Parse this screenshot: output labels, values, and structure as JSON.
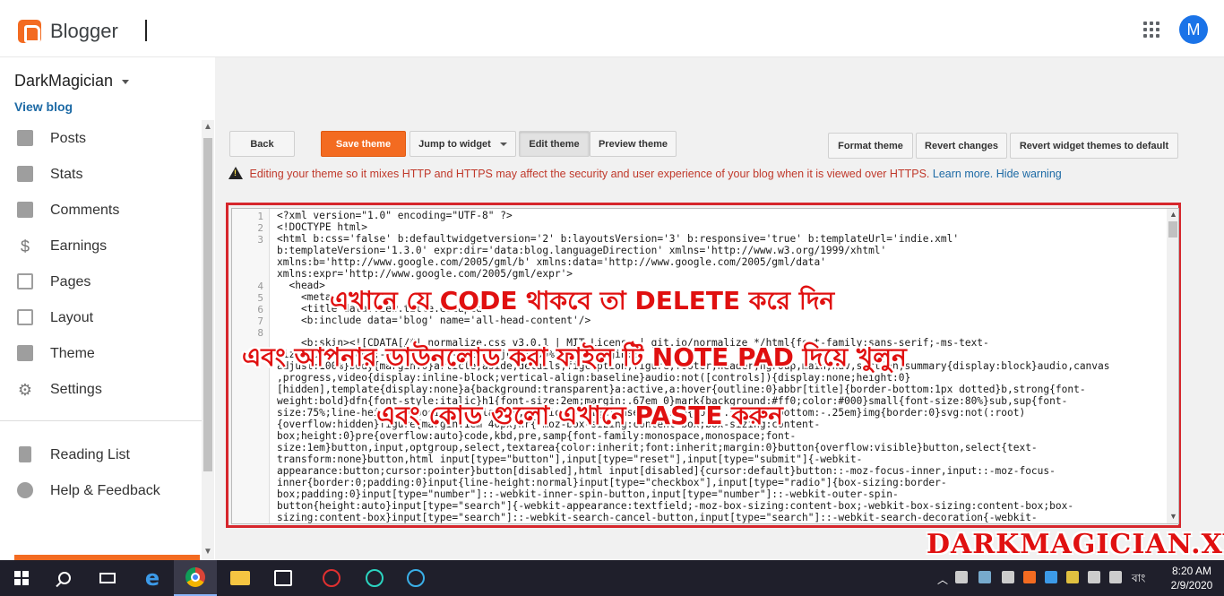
{
  "topbar": {
    "brand": "Blogger",
    "avatar_letter": "M"
  },
  "sidebar": {
    "blog_name": "DarkMagician",
    "view_blog": "View blog",
    "items": [
      {
        "label": "Posts",
        "icon": "posts-icon"
      },
      {
        "label": "Stats",
        "icon": "stats-icon"
      },
      {
        "label": "Comments",
        "icon": "comments-icon"
      },
      {
        "label": "Earnings",
        "icon": "dollar-icon"
      },
      {
        "label": "Pages",
        "icon": "pages-icon"
      },
      {
        "label": "Layout",
        "icon": "layout-icon"
      },
      {
        "label": "Theme",
        "icon": "theme-icon"
      },
      {
        "label": "Settings",
        "icon": "gear-icon"
      }
    ],
    "secondary": [
      {
        "label": "Reading List",
        "icon": "bookmark-icon"
      },
      {
        "label": "Help & Feedback",
        "icon": "help-icon"
      }
    ]
  },
  "toolbar": {
    "back": "Back",
    "save_theme": "Save theme",
    "jump_to_widget": "Jump to widget",
    "edit_theme": "Edit theme",
    "preview_theme": "Preview theme",
    "format_theme": "Format theme",
    "revert_changes": "Revert changes",
    "revert_widget": "Revert widget themes to default"
  },
  "warning": {
    "text": "Editing your theme so it mixes HTTP and HTTPS may affect the security and user experience of your blog when it is viewed over HTTPS.",
    "learn_more": "Learn more.",
    "hide": "Hide warning"
  },
  "editor": {
    "line_numbers": [
      "1",
      "2",
      "3",
      "",
      "",
      "",
      "4",
      "5",
      "6",
      "7",
      "8"
    ],
    "lines": [
      "<?xml version=\"1.0\" encoding=\"UTF-8\" ?>",
      "<!DOCTYPE html>",
      "<html b:css='false' b:defaultwidgetversion='2' b:layoutsVersion='3' b:responsive='true' b:templateUrl='indie.xml'",
      "b:templateVersion='1.3.0' expr:dir='data:blog.languageDirection' xmlns='http://www.w3.org/1999/xhtml'",
      "xmlns:b='http://www.google.com/2005/gml/b' xmlns:data='http://www.google.com/2005/gml/data'",
      "xmlns:expr='http://www.google.com/2005/gml/expr'>",
      "  <head>",
      "    <meta",
      "    <title data:view.title.escaped",
      "    <b:include data='blog' name='all-head-content'/>",
      "",
      "    <b:skin><![CDATA[/*! normalize.css v3.0.1 | MIT License | git.io/normalize */html{font-family:sans-serif;-ms-text-",
      "size-adjust:100%;-webkit-text-size-adjust:100%}body{margin:0}",
      "adjust:100%}body{margin:0}article,aside,details,figcaption,figure,footer,header,hgroup,main,nav,section,summary{display:block}audio,canvas",
      ",progress,video{display:inline-block;vertical-align:baseline}audio:not([controls]){display:none;height:0}",
      "[hidden],template{display:none}a{background:transparent}a:active,a:hover{outline:0}abbr[title]{border-bottom:1px dotted}b,strong{font-",
      "weight:bold}dfn{font-style:italic}h1{font-size:2em;margin:.67em 0}mark{background:#ff0;color:#000}small{font-size:80%}sub,sup{font-",
      "size:75%;line-height:0;position:relative;vertical-align:baseline}sup{top:-.5em}sub{bottom:-.25em}img{border:0}svg:not(:root)",
      "{overflow:hidden}figure{margin:1em 40px}hr{-moz-box-sizing:content-box;box-sizing:content-",
      "box;height:0}pre{overflow:auto}code,kbd,pre,samp{font-family:monospace,monospace;font-",
      "size:1em}button,input,optgroup,select,textarea{color:inherit;font:inherit;margin:0}button{overflow:visible}button,select{text-",
      "transform:none}button,html input[type=\"button\"],input[type=\"reset\"],input[type=\"submit\"]{-webkit-",
      "appearance:button;cursor:pointer}button[disabled],html input[disabled]{cursor:default}button::-moz-focus-inner,input::-moz-focus-",
      "inner{border:0;padding:0}input{line-height:normal}input[type=\"checkbox\"],input[type=\"radio\"]{box-sizing:border-",
      "box;padding:0}input[type=\"number\"]::-webkit-inner-spin-button,input[type=\"number\"]::-webkit-outer-spin-",
      "button{height:auto}input[type=\"search\"]{-webkit-appearance:textfield;-moz-box-sizing:content-box;-webkit-box-sizing:content-box;box-",
      "sizing:content-box}input[type=\"search\"]::-webkit-search-cancel-button,input[type=\"search\"]::-webkit-search-decoration{-webkit-"
    ]
  },
  "overlay": {
    "line1": "এখানে যে CODE থাকবে তা DELETE করে দিন",
    "line2": "এবং আপনার ডাউনলোড করা ফাইল টি NOTE PAD দিয়ে খুলুন",
    "line3": "এবং কোড গুলো এখানে PASTE করুন",
    "watermark": "DARKMAGICIAN.XYZ"
  },
  "taskbar": {
    "lang": "বাং",
    "time": "8:20 AM",
    "date": "2/9/2020"
  },
  "colors": {
    "accent": "#f36b21",
    "link": "#1d6aa5",
    "warning": "#c0392b",
    "highlight_frame": "#d6262c"
  }
}
